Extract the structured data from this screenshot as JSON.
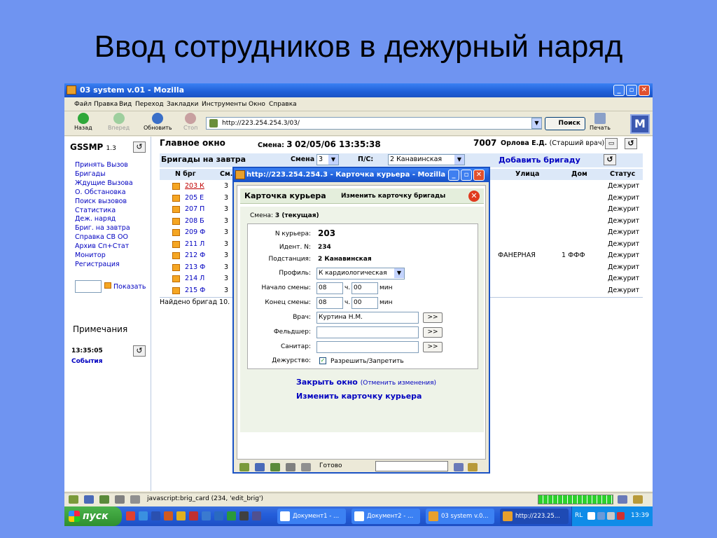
{
  "slide": {
    "title": "Ввод сотрудников в дежурный наряд"
  },
  "window": {
    "title": "03 system v.01 - Mozilla"
  },
  "menu": [
    "Файл",
    "Правка",
    "Вид",
    "Переход",
    "Закладки",
    "Инструменты",
    "Окно",
    "Справка"
  ],
  "toolbar": {
    "back": "Назад",
    "forward": "Вперед",
    "reload": "Обновить",
    "stop": "Стоп",
    "url": "http://223.254.254.3/03/",
    "search": "Поиск",
    "print": "Печать"
  },
  "sidebar": {
    "app": "GSSMP",
    "version": "1.3",
    "items": [
      "Принять Вызов",
      "Бригады",
      "Ждущие Вызова",
      "О. Обстановка",
      "Поиск вызовов",
      "Статистика",
      "Деж. наряд",
      "Бриг. на завтра",
      "Справка СВ ОО",
      "Архив Сп+Стат",
      "Монитор",
      "Регистрация"
    ],
    "show": "Показать",
    "notes_title": "Примечания",
    "note_time": "13:35:05",
    "events": "События"
  },
  "main": {
    "title": "Главное окно",
    "shift_label": "Смена:",
    "shift_num": "3",
    "datetime": "02/05/06  13:35:38",
    "number": "7007",
    "user_name": "Орлова Е.Д.",
    "user_role": "(Старший врач)",
    "sub_title": "Бригады на завтра",
    "smena_label": "Смена",
    "smena_value": "3",
    "ps_label": "П/С:",
    "ps_value": "2 Канавинская",
    "add_brigade": "Добавить бригаду",
    "columns": {
      "nbrg": "N брг",
      "sm": "См.",
      "street": "Улица",
      "house": "Дом",
      "status": "Статус"
    },
    "rows": [
      {
        "nbrg": "203 К",
        "sm": "3",
        "street": "",
        "house": "",
        "status": "Дежурит"
      },
      {
        "nbrg": "205 Е",
        "sm": "3",
        "street": "",
        "house": "",
        "status": "Дежурит"
      },
      {
        "nbrg": "207 П",
        "sm": "3",
        "street": "",
        "house": "",
        "status": "Дежурит"
      },
      {
        "nbrg": "208 Б",
        "sm": "3",
        "street": "",
        "house": "",
        "status": "Дежурит"
      },
      {
        "nbrg": "209 Ф",
        "sm": "3",
        "street": "",
        "house": "",
        "status": "Дежурит"
      },
      {
        "nbrg": "211 Л",
        "sm": "3",
        "street": "",
        "house": "",
        "status": "Дежурит"
      },
      {
        "nbrg": "212 Ф",
        "sm": "3",
        "street": "ФАНЕРНАЯ",
        "house": "1 ФФФ",
        "status": "Дежурит"
      },
      {
        "nbrg": "213 Ф",
        "sm": "3",
        "street": "",
        "house": "",
        "status": "Дежурит"
      },
      {
        "nbrg": "214 Л",
        "sm": "3",
        "street": "",
        "house": "",
        "status": "Дежурит"
      },
      {
        "nbrg": "215 Ф",
        "sm": "3",
        "street": "",
        "house": "",
        "status": "Дежурит"
      }
    ],
    "found": "Найдено бригад 10."
  },
  "status": {
    "message": "javascript:brig_card (234, 'edit_brig')"
  },
  "taskbar": {
    "start": "пуск",
    "tasks": [
      "Документ1 - ...",
      "Документ2 - ...",
      "03 system v.0...",
      "http://223.25..."
    ],
    "lang": "RL",
    "clock": "13:39"
  },
  "popup": {
    "title": "http://223.254.254.3 - Карточка курьера - Mozilla",
    "card_title": "Карточка курьера",
    "edit_card": "Изменить карточку бригады",
    "shift_label": "Смена:",
    "shift_value": "3 (текущая)",
    "courier_label": "N курьера:",
    "courier_value": "203",
    "ident_label": "Идент. N:",
    "ident_value": "234",
    "station_label": "Подстанция:",
    "station_value": "2 Канавинская",
    "profile_label": "Профиль:",
    "profile_value": "К кардиологическая",
    "start_label": "Начало смены:",
    "start_h": "08",
    "start_m": "00",
    "end_label": "Конец смены:",
    "end_h": "08",
    "end_m": "00",
    "unit_h": "ч.",
    "unit_m": "мин",
    "doctor_label": "Врач:",
    "doctor_value": "Куртина Н.М.",
    "feldsher_label": "Фельдшер:",
    "feldsher_value": "",
    "sanitar_label": "Санитар:",
    "sanitar_value": "",
    "pick": ">>",
    "duty_label": "Дежурство:",
    "duty_text": "Разрешить/Запретить",
    "close_link": "Закрыть окно",
    "cancel_changes": "(Отменить изменения)",
    "edit_courier": "Изменить карточку курьера",
    "status": "Готово"
  }
}
